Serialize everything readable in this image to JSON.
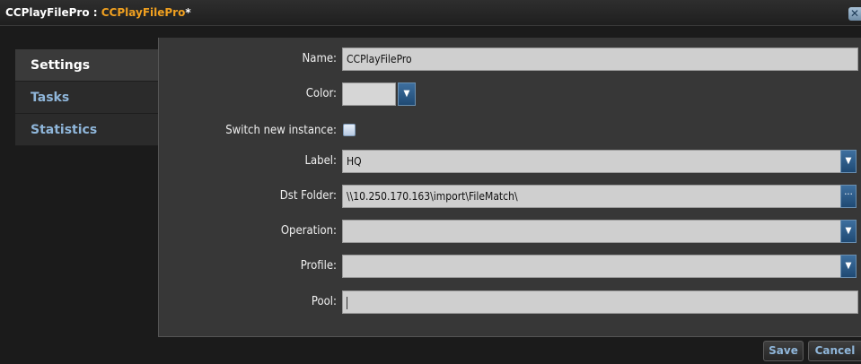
{
  "window": {
    "title_prefix": "CCPlayFilePro : ",
    "title_name": "CCPlayFilePro",
    "title_suffix": "*",
    "close_glyph": "✕"
  },
  "sidebar": {
    "items": [
      {
        "label": "Settings",
        "active": true
      },
      {
        "label": "Tasks",
        "active": false
      },
      {
        "label": "Statistics",
        "active": false
      }
    ]
  },
  "form": {
    "name_label": "Name:",
    "name_value": "CCPlayFilePro",
    "color_label": "Color:",
    "color_value": "",
    "switch_label": "Switch new instance:",
    "switch_checked": false,
    "label_label": "Label:",
    "label_value": "HQ",
    "dst_label": "Dst Folder:",
    "dst_value": "\\\\10.250.170.163\\import\\FileMatch\\",
    "dst_browse_glyph": "···",
    "operation_label": "Operation:",
    "operation_value": "",
    "profile_label": "Profile:",
    "profile_value": "",
    "pool_label": "Pool:",
    "pool_value": ""
  },
  "icons": {
    "dropdown": "chevron-down-icon",
    "dropdown_glyph": "▼"
  },
  "footer": {
    "save_label": "Save",
    "cancel_label": "Cancel"
  }
}
